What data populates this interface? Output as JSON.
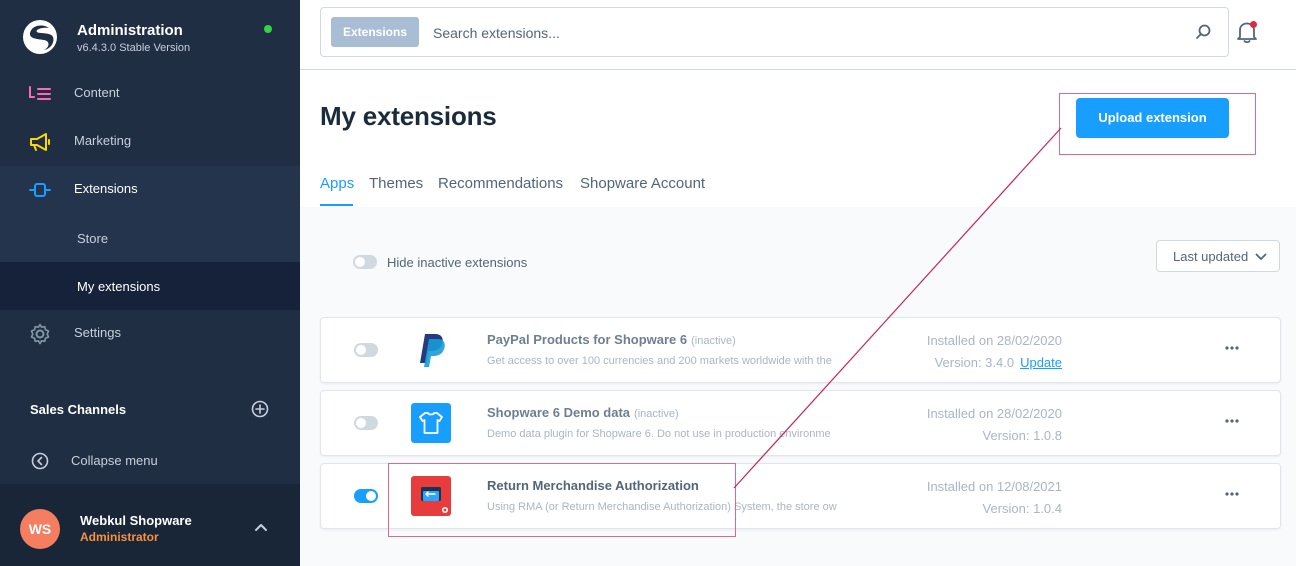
{
  "app": {
    "title": "Administration",
    "version": "v6.4.3.0 Stable Version"
  },
  "sidebar": {
    "items": [
      {
        "label": "Content",
        "icon": "content-icon"
      },
      {
        "label": "Marketing",
        "icon": "megaphone-icon"
      },
      {
        "label": "Extensions",
        "icon": "plug-icon"
      },
      {
        "label": "Settings",
        "icon": "gear-icon"
      }
    ],
    "sub_items": [
      {
        "label": "Store"
      },
      {
        "label": "My extensions"
      }
    ],
    "sales_channels_label": "Sales Channels",
    "collapse_label": "Collapse menu"
  },
  "user": {
    "initials": "WS",
    "name": "Webkul Shopware",
    "role": "Administrator"
  },
  "search": {
    "chip": "Extensions",
    "placeholder": "Search extensions..."
  },
  "page": {
    "title": "My extensions",
    "upload_label": "Upload extension"
  },
  "tabs": [
    {
      "label": "Apps"
    },
    {
      "label": "Themes"
    },
    {
      "label": "Recommendations"
    },
    {
      "label": "Shopware Account"
    }
  ],
  "filters": {
    "hide_inactive_label": "Hide inactive extensions",
    "sort_label": "Last updated"
  },
  "extensions": [
    {
      "name": "PayPal Products for Shopware 6",
      "status": "(inactive)",
      "description": "Get access to over 100 currencies and 200 markets worldwide with the",
      "installed": "Installed on 28/02/2020",
      "version": "Version: 3.4.0",
      "update_label": "Update",
      "active": false
    },
    {
      "name": "Shopware 6 Demo data",
      "status": "(inactive)",
      "description": "Demo data plugin for Shopware 6. Do not use in production environme",
      "installed": "Installed on 28/02/2020",
      "version": "Version: 1.0.8",
      "active": false
    },
    {
      "name": "Return Merchandise Authorization",
      "description": "Using RMA (or Return Merchandise Authorization) System, the store ow",
      "installed": "Installed on 12/08/2021",
      "version": "Version: 1.0.4",
      "active": true
    }
  ],
  "colors": {
    "sidebar_bg": "#1f2e43",
    "accent": "#189eff",
    "annotation": "#d96a90"
  }
}
